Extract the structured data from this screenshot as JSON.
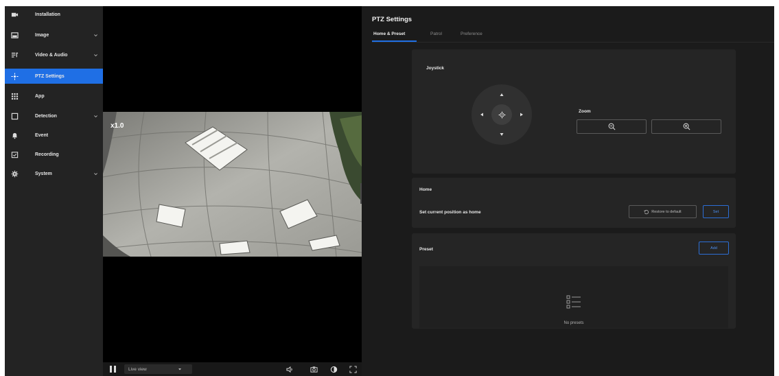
{
  "sidebar": {
    "items": [
      {
        "label": "Installation",
        "icon": "video-camera-icon",
        "active": false,
        "has_submenu": false
      },
      {
        "label": "Image",
        "icon": "image-icon",
        "active": false,
        "has_submenu": true
      },
      {
        "label": "Video & Audio",
        "icon": "video-audio-icon",
        "active": false,
        "has_submenu": true
      },
      {
        "label": "PTZ Settings",
        "icon": "ptz-icon",
        "active": true,
        "has_submenu": false
      },
      {
        "label": "App",
        "icon": "app-grid-icon",
        "active": false,
        "has_submenu": false
      },
      {
        "label": "Detection",
        "icon": "detection-icon",
        "active": false,
        "has_submenu": true
      },
      {
        "label": "Event",
        "icon": "bell-icon",
        "active": false,
        "has_submenu": false
      },
      {
        "label": "Recording",
        "icon": "calendar-icon",
        "active": false,
        "has_submenu": false
      },
      {
        "label": "System",
        "icon": "gear-icon",
        "active": false,
        "has_submenu": true
      }
    ]
  },
  "video": {
    "zoom_level": "x1.0",
    "view_mode": "Live view"
  },
  "ptz": {
    "title": "PTZ Settings",
    "tabs": [
      {
        "label": "Home & Preset",
        "active": true
      },
      {
        "label": "Patrol",
        "active": false
      },
      {
        "label": "Preference",
        "active": false
      }
    ],
    "joystick_label": "Joystick",
    "zoom_label": "Zoom",
    "home": {
      "title": "Home",
      "description": "Set current position as home",
      "restore_label": "Restore to default",
      "set_label": "Set"
    },
    "preset": {
      "title": "Preset",
      "add_label": "Add",
      "empty_text": "No presets"
    }
  },
  "colors": {
    "accent": "#1f6fe5",
    "background": "#1b1b1b",
    "card": "#252525",
    "sidebar": "#232323"
  }
}
